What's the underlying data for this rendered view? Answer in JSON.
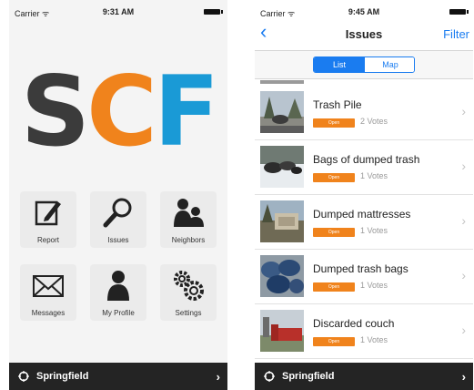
{
  "left_screen": {
    "status": {
      "carrier": "Carrier ᯤ",
      "time": "9:31 AM"
    },
    "logo": {
      "s": "S",
      "c": "C",
      "f": "F",
      "color_s": "#3b3b3b",
      "color_c": "#f0831c",
      "color_f": "#1a9ad6"
    },
    "tiles": [
      {
        "label": "Report",
        "icon": "edit-icon"
      },
      {
        "label": "Issues",
        "icon": "search-icon"
      },
      {
        "label": "Neighbors",
        "icon": "people-icon"
      },
      {
        "label": "Messages",
        "icon": "mail-icon"
      },
      {
        "label": "My Profile",
        "icon": "user-icon"
      },
      {
        "label": "Settings",
        "icon": "gears-icon"
      }
    ],
    "bottom": {
      "city": "Springfield",
      "arrow": "›"
    }
  },
  "right_screen": {
    "status": {
      "carrier": "Carrier ᯤ",
      "time": "9:45 AM"
    },
    "nav": {
      "back": "‹",
      "title": "Issues",
      "filter": "Filter"
    },
    "segments": {
      "list": "List",
      "map": "Map"
    },
    "issues": [
      {
        "title": "Trash Pile",
        "status": "Open",
        "votes": "2 Votes"
      },
      {
        "title": "Bags of dumped trash",
        "status": "Open",
        "votes": "1 Votes"
      },
      {
        "title": "Dumped mattresses",
        "status": "Open",
        "votes": "1 Votes"
      },
      {
        "title": "Dumped trash bags",
        "status": "Open",
        "votes": "1 Votes"
      },
      {
        "title": "Discarded couch",
        "status": "Open",
        "votes": "1 Votes"
      }
    ],
    "bottom": {
      "city": "Springfield",
      "arrow": "›"
    }
  },
  "colors": {
    "accent_blue": "#1a7cf0",
    "badge_orange": "#f0831c",
    "bar_dark": "#242424"
  }
}
